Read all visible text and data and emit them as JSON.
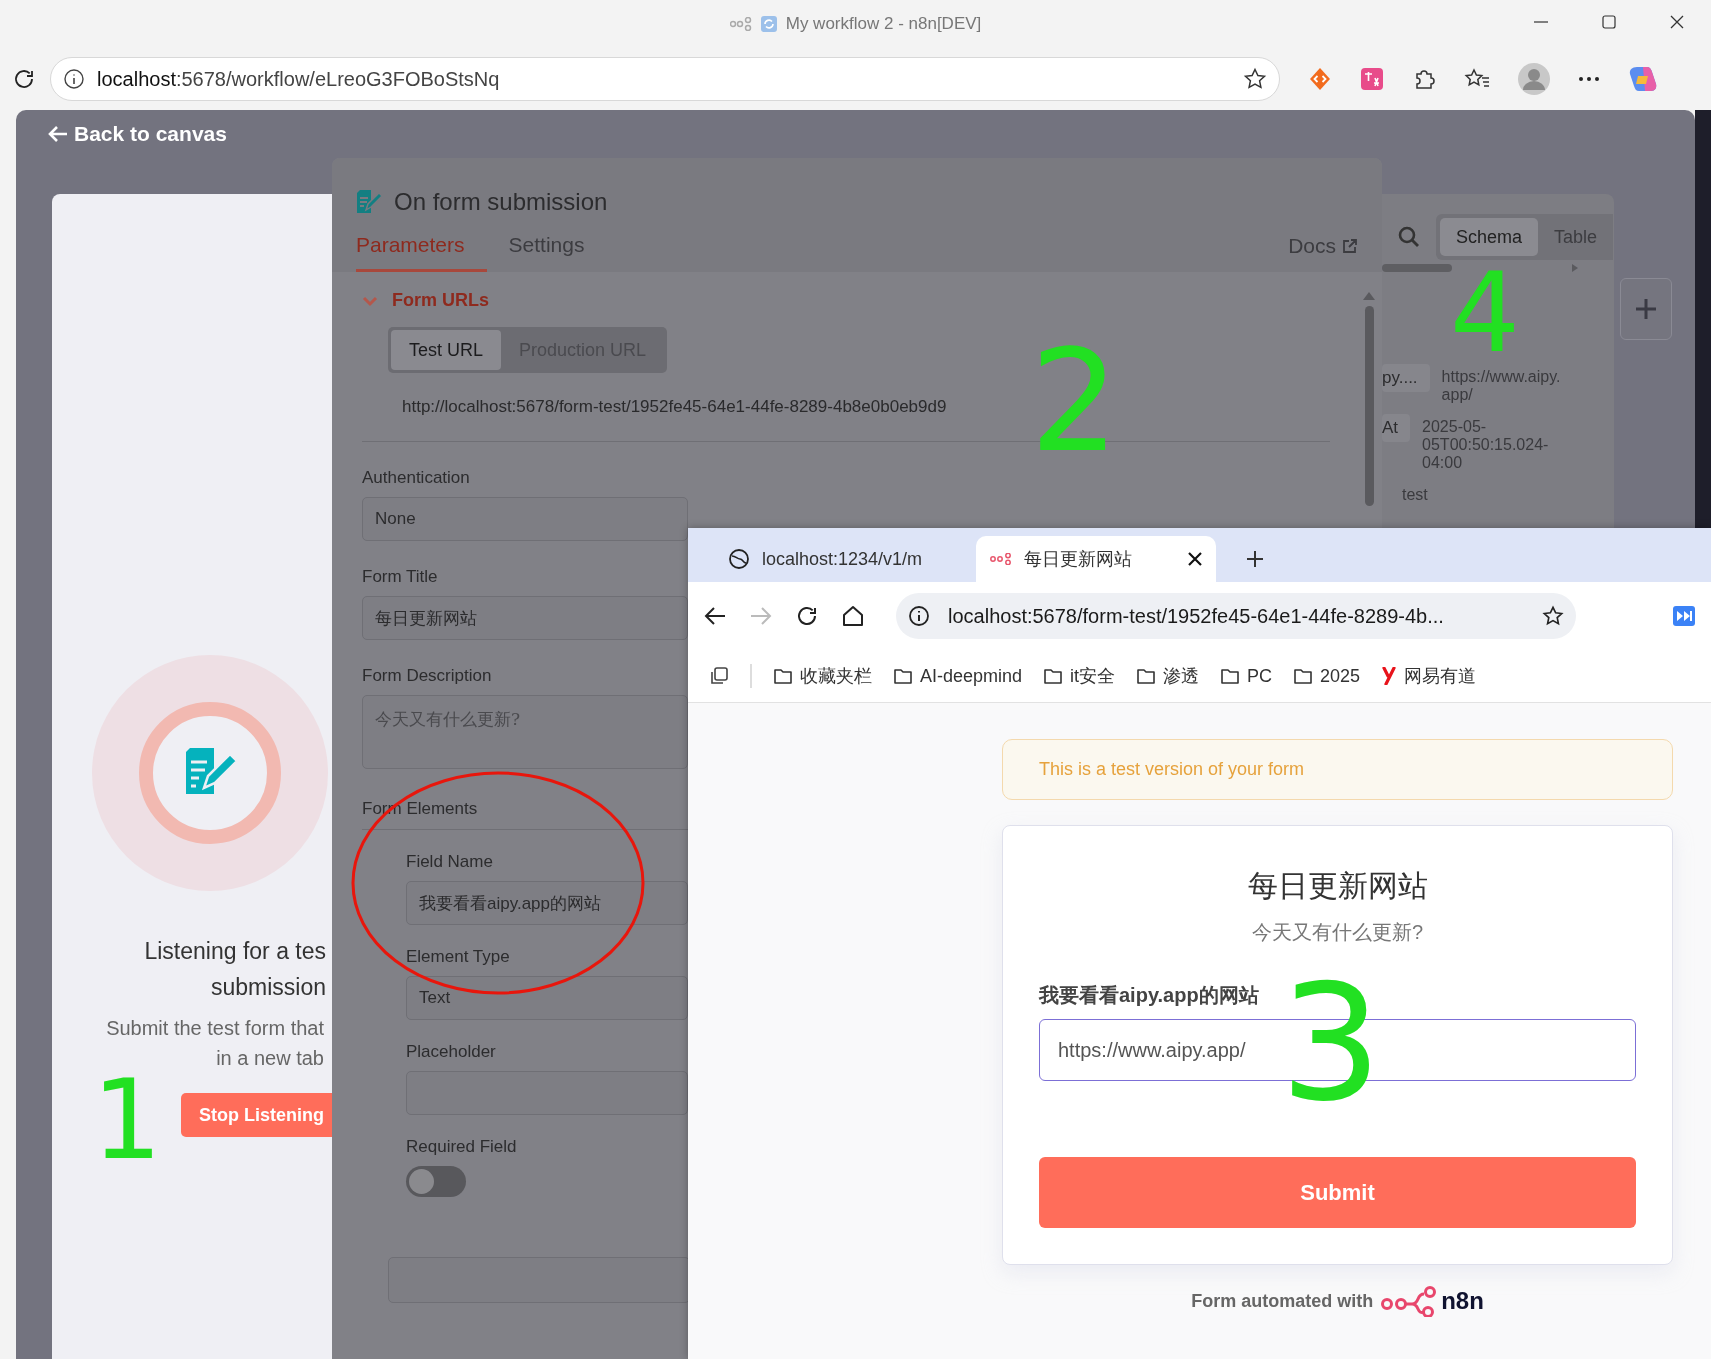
{
  "browser": {
    "tab_title": "My workflow 2 - n8n[DEV]",
    "host": "localhost",
    "path": ":5678/workflow/eLreoG3FOBoStsNq"
  },
  "app": {
    "back_link": "Back to canvas",
    "input_panel": {
      "heading_lines": [
        "Listening for a tes",
        "submission"
      ],
      "hint_lines": [
        "Submit the test form that",
        "in a new tab"
      ],
      "button": "Stop Listening"
    },
    "node": {
      "title": "On form submission",
      "tabs": [
        {
          "label": "Parameters",
          "selected": true
        },
        {
          "label": "Settings",
          "selected": false
        }
      ],
      "docs": "Docs",
      "section": {
        "label": "Form URLs",
        "expanded": true
      },
      "url_tabs": [
        {
          "label": "Test URL",
          "selected": true
        },
        {
          "label": "Production URL",
          "selected": false
        }
      ],
      "url": "http://localhost:5678/form-test/1952fe45-64e1-44fe-8289-4b8e0b0eb9d9",
      "fields": [
        {
          "kind": "select",
          "label": "Authentication",
          "value": "None"
        },
        {
          "kind": "text",
          "label": "Form Title",
          "value": "每日更新网站"
        },
        {
          "kind": "textarea",
          "label": "Form Description",
          "value": "今天又有什么更新?"
        }
      ],
      "elements_label": "Form Elements",
      "element_fields": [
        {
          "kind": "text",
          "label": "Field Name",
          "value": "我要看看aipy.app的网站"
        },
        {
          "kind": "select",
          "label": "Element Type",
          "value": "Text"
        },
        {
          "kind": "text",
          "label": "Placeholder"
        },
        {
          "kind": "toggle",
          "label": "Required Field",
          "on": false
        }
      ]
    },
    "output": {
      "tabs": [
        {
          "label": "Schema",
          "selected": true
        },
        {
          "label": "Table",
          "selected": false
        }
      ],
      "rows": [
        {
          "key": "py....",
          "value": "https://www.aipy.app/"
        },
        {
          "key": "At",
          "value": "2025-05-05T00:50:15.024-04:00"
        },
        {
          "value": "test"
        }
      ]
    }
  },
  "popup": {
    "tabs": [
      {
        "label": "localhost:1234/v1/m",
        "selected": false
      },
      {
        "label": "每日更新网站",
        "selected": true
      }
    ],
    "address": "localhost:5678/form-test/1952fe45-64e1-44fe-8289-4b...",
    "bookmarks": [
      {
        "kind": "folder",
        "label": "收藏夹栏"
      },
      {
        "kind": "folder",
        "label": "AI-deepmind"
      },
      {
        "kind": "folder",
        "label": "it安全"
      },
      {
        "kind": "folder",
        "label": "渗透"
      },
      {
        "kind": "folder",
        "label": "PC"
      },
      {
        "kind": "folder",
        "label": "2025"
      },
      {
        "kind": "app",
        "label": "网易有道"
      }
    ],
    "form": {
      "banner": "This is a test version of your form",
      "title": "每日更新网站",
      "description": "今天又有什么更新?",
      "field_label": "我要看看aipy.app的网站",
      "field_value": "https://www.aipy.app/",
      "submit": "Submit",
      "footer": "Form automated with",
      "brand": "n8n"
    }
  },
  "annotations": [
    {
      "kind": "digit",
      "text": "1"
    },
    {
      "kind": "digit",
      "text": "2"
    },
    {
      "kind": "digit",
      "text": "3"
    },
    {
      "kind": "digit",
      "text": "4"
    },
    {
      "kind": "circle"
    }
  ]
}
